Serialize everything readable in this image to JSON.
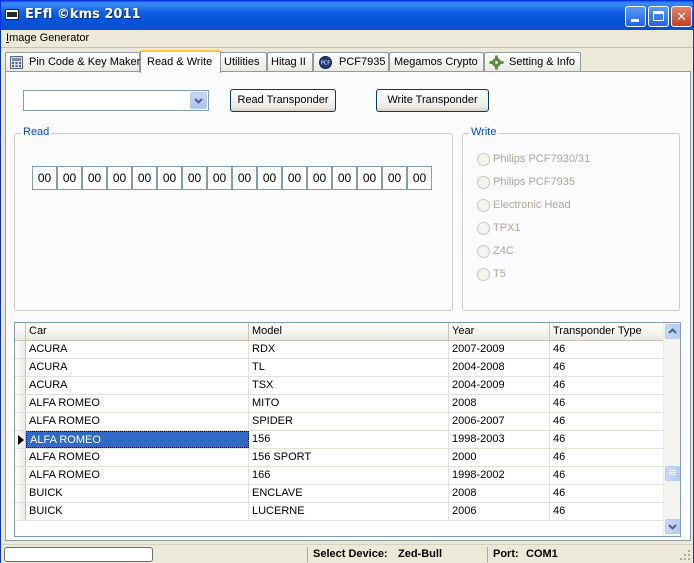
{
  "window": {
    "title": "EFfl  ©kms 2011"
  },
  "menu": {
    "prefix": "I",
    "rest": "mage Generator"
  },
  "tabs": [
    {
      "label": "Pin Code & Key Maker",
      "icon": "calculator-icon"
    },
    {
      "label": "Read & Write",
      "active": true
    },
    {
      "label": "Utilities"
    },
    {
      "label": "Hitag II"
    },
    {
      "label": "PCF7935",
      "icon": "pcf-badge-icon"
    },
    {
      "label": "Megamos Crypto"
    },
    {
      "label": "Setting & Info",
      "icon": "gear-icon"
    }
  ],
  "toolbar": {
    "device_select_value": "",
    "read_button": "Read Transponder",
    "write_button": "Write Transponder"
  },
  "read_group": {
    "title": "Read",
    "bytes": [
      "00",
      "00",
      "00",
      "00",
      "00",
      "00",
      "00",
      "00",
      "00",
      "00",
      "00",
      "00",
      "00",
      "00",
      "00",
      "00"
    ]
  },
  "write_group": {
    "title": "Write",
    "options": [
      "Philips PCF7930/31",
      "Philips PCF7935",
      "Electronic Head",
      "TPX1",
      "Z4C",
      "T5"
    ]
  },
  "grid": {
    "columns": [
      "Car",
      "Model",
      "Year",
      "Transponder Type"
    ],
    "rows": [
      [
        "ACURA",
        "RDX",
        "2007-2009",
        "46"
      ],
      [
        "ACURA",
        "TL",
        "2004-2008",
        "46"
      ],
      [
        "ACURA",
        "TSX",
        "2004-2009",
        "46"
      ],
      [
        "ALFA ROMEO",
        "MITO",
        "2008",
        "46"
      ],
      [
        "ALFA ROMEO",
        "SPIDER",
        "2006-2007",
        "46"
      ],
      [
        "ALFA ROMEO",
        "156",
        "1998-2003",
        "46"
      ],
      [
        "ALFA ROMEO",
        "156 SPORT",
        "2000",
        "46"
      ],
      [
        "ALFA ROMEO",
        "166",
        "1998-2002",
        "46"
      ],
      [
        "BUICK",
        "ENCLAVE",
        "2008",
        "46"
      ],
      [
        "BUICK",
        "LUCERNE",
        "2006",
        "46"
      ]
    ],
    "selected_row": 5
  },
  "status": {
    "device_label": "Select Device:",
    "device_value": "Zed-Bull",
    "port_label": "Port:",
    "port_value": "COM1"
  },
  "colors": {
    "titlebar": "#0553d8",
    "group_title": "#0046d5",
    "selection": "#316ac5",
    "active_tab_accent": "#ffc83c"
  }
}
